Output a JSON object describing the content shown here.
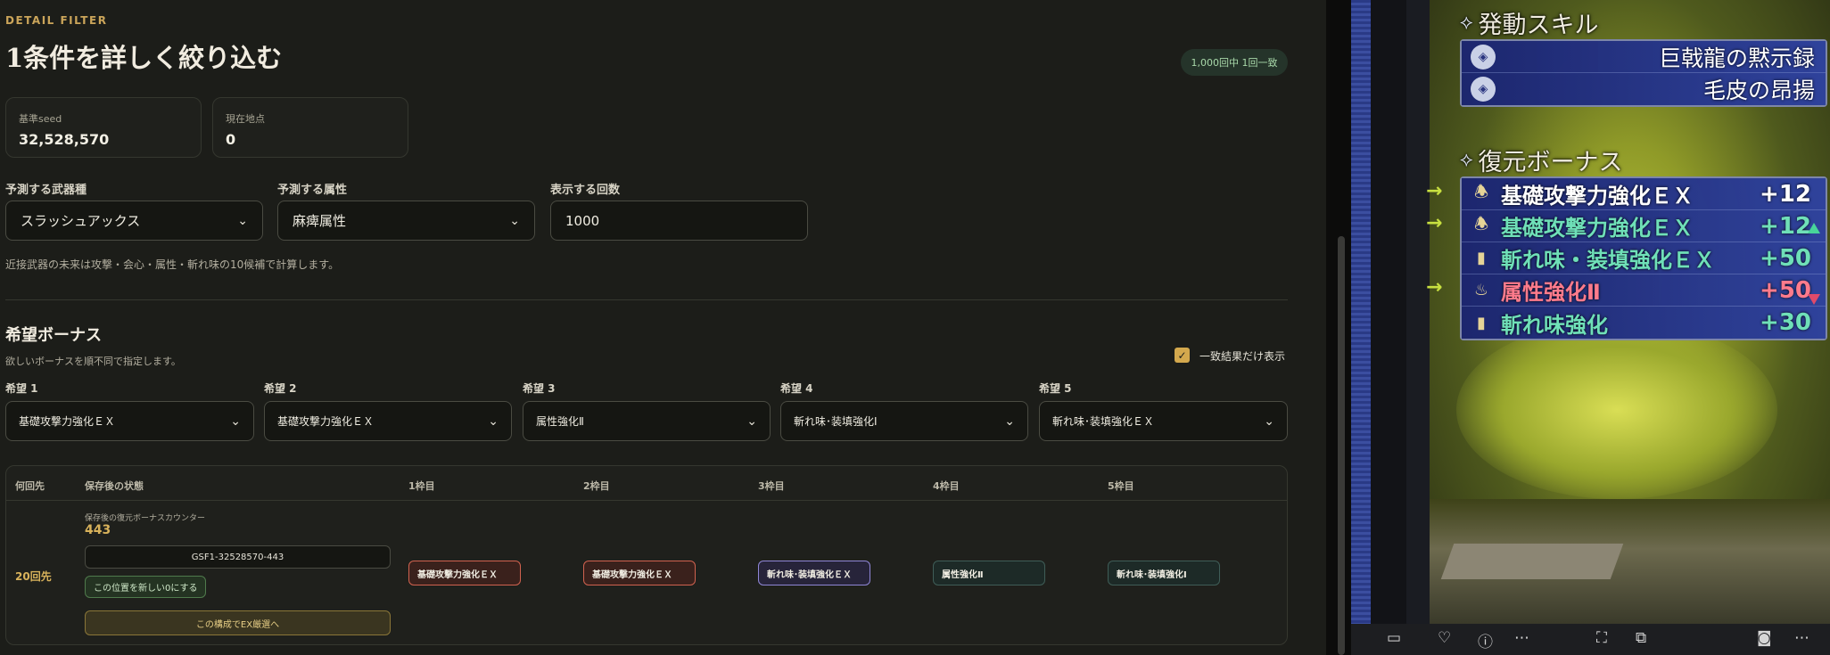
{
  "header": {
    "eyebrow": "DETAIL FILTER",
    "title": "1条件を詳しく絞り込む",
    "match_pill": "1,000回中 1回一致"
  },
  "stats": [
    {
      "label": "基準seed",
      "value": "32,528,570"
    },
    {
      "label": "現在地点",
      "value": "0"
    }
  ],
  "filters": {
    "weapon_label": "予測する武器種",
    "weapon_value": "スラッシュアックス",
    "element_label": "予測する属性",
    "element_value": "麻痺属性",
    "count_label": "表示する回数",
    "count_value": "1000",
    "note": "近接武器の未来は攻撃・会心・属性・斬れ味の10候補で計算します。"
  },
  "wishes": {
    "title": "希望ボーナス",
    "subtitle": "欲しいボーナスを順不同で指定します。",
    "only_match_label": "一致結果だけ表示",
    "only_match_checked": true,
    "items": [
      {
        "label": "希望 1",
        "value": "基礎攻撃力強化ＥＸ"
      },
      {
        "label": "希望 2",
        "value": "基礎攻撃力強化ＥＸ"
      },
      {
        "label": "希望 3",
        "value": "属性強化Ⅱ"
      },
      {
        "label": "希望 4",
        "value": "斬れ味･装填強化Ⅰ"
      },
      {
        "label": "希望 5",
        "value": "斬れ味･装填強化ＥＸ"
      }
    ]
  },
  "table": {
    "headers": [
      "何回先",
      "保存後の状態",
      "1枠目",
      "2枠目",
      "3枠目",
      "4枠目",
      "5枠目"
    ],
    "row": {
      "count": "20回先",
      "state_label": "保存後の復元ボーナスカウンター",
      "state_value": "443",
      "code": "GSF1-32528570-443",
      "reset_button": "この位置を新しい0にする",
      "ex_button": "この構成でEX厳選へ",
      "slots": [
        {
          "text": "基礎攻撃力強化ＥＸ",
          "color": "#d0624f"
        },
        {
          "text": "基礎攻撃力強化ＥＸ",
          "color": "#d0624f"
        },
        {
          "text": "斬れ味･装填強化ＥＸ",
          "color": "#8f86d6"
        },
        {
          "text": "属性強化Ⅱ",
          "color": "#3f5d57"
        },
        {
          "text": "斬れ味･装填強化Ⅰ",
          "color": "#3f5d57"
        }
      ]
    }
  },
  "game": {
    "skills_header": "発動スキル",
    "skills": [
      "巨戟龍の黙示録",
      "毛皮の昂揚"
    ],
    "bonus_header": "復元ボーナス",
    "bonuses": [
      {
        "name": "基礎攻撃力強化ＥＸ",
        "value": "+12",
        "color": "#ffffff",
        "arrow": true
      },
      {
        "name": "基礎攻撃力強化ＥＸ",
        "value": "+12",
        "color": "#6fe0b8",
        "arrow": true
      },
      {
        "name": "斬れ味・装填強化ＥＸ",
        "value": "+50",
        "color": "#6fe0b8",
        "arrow": false
      },
      {
        "name": "属性強化Ⅱ",
        "value": "+50",
        "color": "#ff7b8c",
        "arrow": true
      },
      {
        "name": "斬れ味強化",
        "value": "+30",
        "color": "#6fe0b8",
        "arrow": false
      }
    ]
  },
  "viewer_bar_icons": [
    "subtitle-icon",
    "heart-icon",
    "info-icon",
    "more-icon",
    "crop-icon",
    "scan-icon",
    "screenshot-icon",
    "more-icon"
  ]
}
